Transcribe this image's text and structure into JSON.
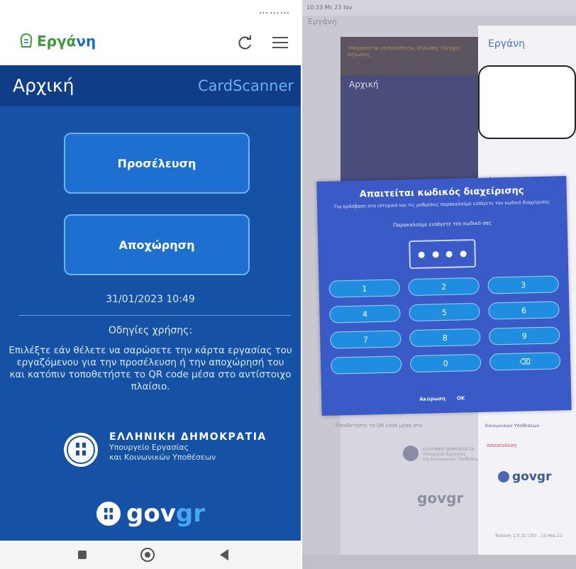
{
  "left_screen": {
    "status": "………",
    "app_name_part1": "Εργά",
    "app_name_part2": "νη",
    "header": {
      "title": "Αρχική",
      "link": "CardScanner"
    },
    "buttons": {
      "check_in": "Προσέλευση",
      "check_out": "Αποχώρηση"
    },
    "datetime": "31/01/2023 10:49",
    "instructions": {
      "title": "Οδηγίες χρήσης:",
      "body": "Επιλέξτε εάν θέλετε να σαρώσετε την κάρτα εργασίας του εργαζόμενου για την προσέλευση ή την αποχώρησή του και κατόπιν τοποθετήστε το QR code μέσα στο αντίστοιχο πλαίσιο."
    },
    "ministry": {
      "title": "ΕΛΛΗΝΙΚΗ ΔΗΜΟΚΡΑΤΙΑ",
      "line1": "Υπουργείο Εργασίας",
      "line2": "και Κοινωνικών Υποθέσεων"
    },
    "govgr_part1": "gov",
    "govgr_part2": "gr"
  },
  "right_screen": {
    "status_text": "10:33  Με 23 Ιαν",
    "drawer_logo": "Εργάνη",
    "bg_logo": "Εργάνη",
    "bg_banner": "Υποχρεούται επιπρόσθετος δήλωσης έλεγχος δήλωσης",
    "bg_home": "Αρχική",
    "drawer_home": "Αρχική",
    "drawer_item_ministry": "Κοινωνικών Υποθέσεων",
    "drawer_item_logout": "Αποσύνδεση",
    "drawer_govgr": "govgr",
    "drawer_version": "Έκδοση 1.0.31 (20) - 15-Μαϊ-21",
    "bg_lower_text": "Τοποθετήστε το QR code μέσα στο",
    "bg_gov_line1": "ΕΛΛΗΝΙΚΗ ΔΗΜΟΚΡΑΤΙΑ",
    "bg_gov_line2": "Υπουργείο Εργασίας",
    "bg_gov_line3": "και Κοινωνικών Υποθέσεων",
    "bg_govgr": "govgr",
    "dialog": {
      "title": "Απαιτείται κωδικός διαχείρισης",
      "subtitle": "Για πρόσβαση στο ιστορικό και τις ρυθμίσεις παρακαλούμε εισάγετε τον κωδικό διαχείρισης",
      "prompt": "Παρακαλούμε εισάγετε τον κωδικό σας",
      "keys": [
        "1",
        "2",
        "3",
        "4",
        "5",
        "6",
        "7",
        "8",
        "9",
        "",
        "0",
        "⌫"
      ],
      "cancel": "Ακύρωση",
      "ok": "OK"
    }
  },
  "colors": {
    "primary_blue": "#1552a6",
    "header_blue": "#0f3d88",
    "button_blue": "#1d6fd0",
    "dialog_blue": "#3a5bc7",
    "key_blue": "#1f8ee0",
    "logo_green": "#3c9a3c"
  }
}
